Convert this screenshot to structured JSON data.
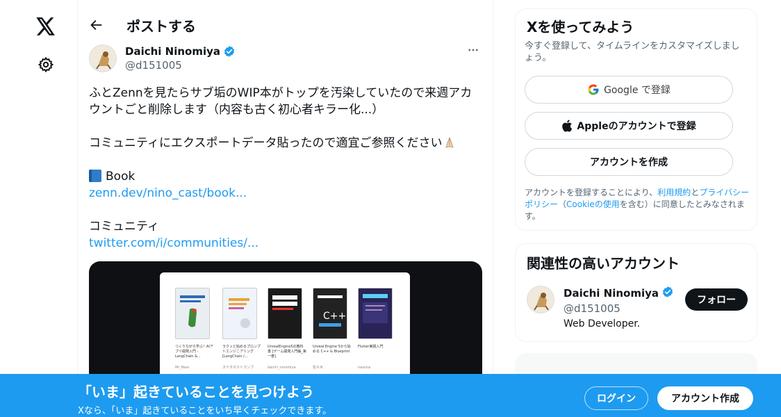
{
  "nav": {
    "logo_icon": "x-logo-icon",
    "settings_icon": "gear-icon"
  },
  "header": {
    "title": "ポストする",
    "back_icon": "arrow-left-icon"
  },
  "post": {
    "author_name": "Daichi Ninomiya",
    "handle": "@d151005",
    "text_line1": "ふとZennを見たらサブ垢のWIP本がトップを汚染していたので来週アカウントごと削除します（内容も古く初心者キラー化...）",
    "text_line2": "コミュニティにエクスポートデータ貼ったので適宜ご参照ください",
    "book_label": "Book",
    "book_link": "zenn.dev/nino_cast/book...",
    "community_label": "コミュニティ",
    "community_link": "twitter.com/i/communities/...",
    "media_books": [
      {
        "caption": "つくりながら学ぶ！AIアプリ開発入門 - LangChain &...",
        "author": "Mr_Bear",
        "color": "#e9eef2"
      },
      {
        "caption": "ラクッと始めるプロンプトエンジニアリング [LangChain /...",
        "author": "ヌヤタポストランプ",
        "color": "#eef4f9"
      },
      {
        "caption": "UnrealEngine5の教科書 [ゲーム開発入門編_第一巻]",
        "author": "daichi_ninomiya",
        "color": "#1a1a1a"
      },
      {
        "caption": "Unreal Engine 5から始める C++ & Blueprint",
        "author": "佐々木",
        "color": "#222222"
      },
      {
        "caption": "Flutter実践入門",
        "author": "nazuna",
        "color": "#2a2456"
      }
    ]
  },
  "signup_card": {
    "title": "Xを使ってみよう",
    "subtitle": "今すぐ登録して、タイムラインをカスタマイズしましょう。",
    "google_button": "Google で登録",
    "apple_button": "Appleのアカウントで登録",
    "create_button": "アカウントを作成",
    "legal_prefix": "アカウントを登録することにより、",
    "legal_terms": "利用規約",
    "legal_and": "と",
    "legal_privacy": "プライバシーポリシー",
    "legal_paren_open": "（",
    "legal_cookie": "Cookieの使用",
    "legal_suffix": "を含む）に同意したとみなされます。"
  },
  "related": {
    "title": "関連性の高いアカウント",
    "name": "Daichi Ninomiya",
    "handle": "@d151005",
    "bio": "Web Developer.",
    "follow_label": "フォロー"
  },
  "banner": {
    "title": "「いま」起きていることを見つけよう",
    "subtitle": "Xなら、「いま」起きていることをいち早くチェックできます。",
    "login_label": "ログイン",
    "signup_label": "アカウント作成"
  },
  "colors": {
    "accent": "#1d9bf0",
    "text": "#0f1419",
    "muted": "#536471"
  }
}
